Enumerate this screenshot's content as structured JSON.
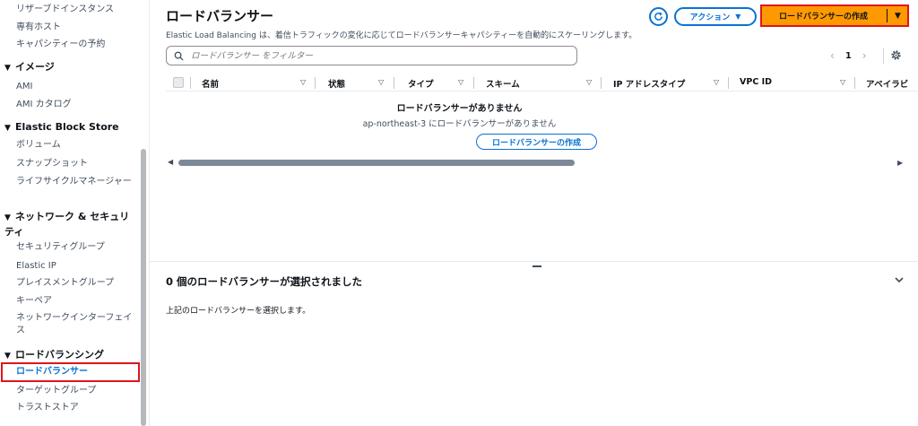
{
  "sidebar": {
    "top_items": [
      "リザーブドインスタンス",
      "専有ホスト",
      "キャパシティーの予約"
    ],
    "sections": [
      {
        "title": "イメージ",
        "items": [
          "AMI",
          "AMI カタログ"
        ]
      },
      {
        "title": "Elastic Block Store",
        "items": [
          "ボリューム",
          "スナップショット",
          "ライフサイクルマネージャー"
        ]
      },
      {
        "title": "ネットワーク & セキュリティ",
        "items": [
          "セキュリティグループ",
          "Elastic IP",
          "プレイスメントグループ",
          "キーペア",
          "ネットワークインターフェイス"
        ]
      },
      {
        "title": "ロードバランシング",
        "items": [
          "ロードバランサー",
          "ターゲットグループ",
          "トラストストア"
        ]
      }
    ]
  },
  "header": {
    "title": "ロードバランサー",
    "description": "Elastic Load Balancing は、着信トラフィックの変化に応じてロードバランサーキャパシティーを自動的にスケーリングします。",
    "actions_label": "アクション",
    "create_label": "ロードバランサーの作成"
  },
  "filter": {
    "placeholder": "ロードバランサー をフィルター"
  },
  "pager": {
    "page": "1"
  },
  "table": {
    "columns": [
      "名前",
      "状態",
      "タイプ",
      "スキーム",
      "IP アドレスタイプ",
      "VPC ID",
      "アベイラビ"
    ],
    "empty_title": "ロードバランサーがありません",
    "empty_sub": "ap-northeast-3 にロードバランサーがありません",
    "empty_button": "ロードバランサーの作成"
  },
  "split": {
    "title": "0 個のロードバランサーが選択されました",
    "body": "上記のロードバランサーを選択します。"
  },
  "colors": {
    "primary": "#0972d3",
    "cta": "#ff9900",
    "highlight": "#e0141e"
  }
}
